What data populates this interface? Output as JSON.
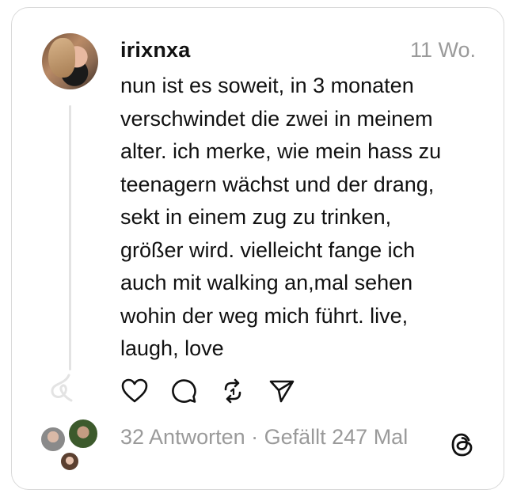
{
  "post": {
    "username": "irixnxa",
    "timestamp": "11 Wo.",
    "text_lines": [
      "nun ist es soweit, in 3 monaten",
      "verschwindet die zwei in meinem",
      "alter. ich merke, wie mein hass zu",
      "teenagern wächst und der drang,",
      "sekt in einem zug zu trinken,",
      "größer wird. vielleicht fange ich",
      "auch mit walking an,mal sehen",
      "wohin der weg mich führt. live,",
      "laugh, love"
    ]
  },
  "actions": [
    {
      "name": "like",
      "icon": "heart-icon"
    },
    {
      "name": "reply",
      "icon": "comment-icon"
    },
    {
      "name": "repost",
      "icon": "repost-icon"
    },
    {
      "name": "share",
      "icon": "send-icon"
    }
  ],
  "stats": {
    "replies": "32 Antworten",
    "separator": "·",
    "likes": "Gefällt 247 Mal",
    "full": "32 Antworten · Gefällt 247 Mal"
  },
  "colors": {
    "text": "#111111",
    "muted": "#9a9a9a",
    "border": "#d9d9d9",
    "thread_line": "#e3e3e3"
  }
}
